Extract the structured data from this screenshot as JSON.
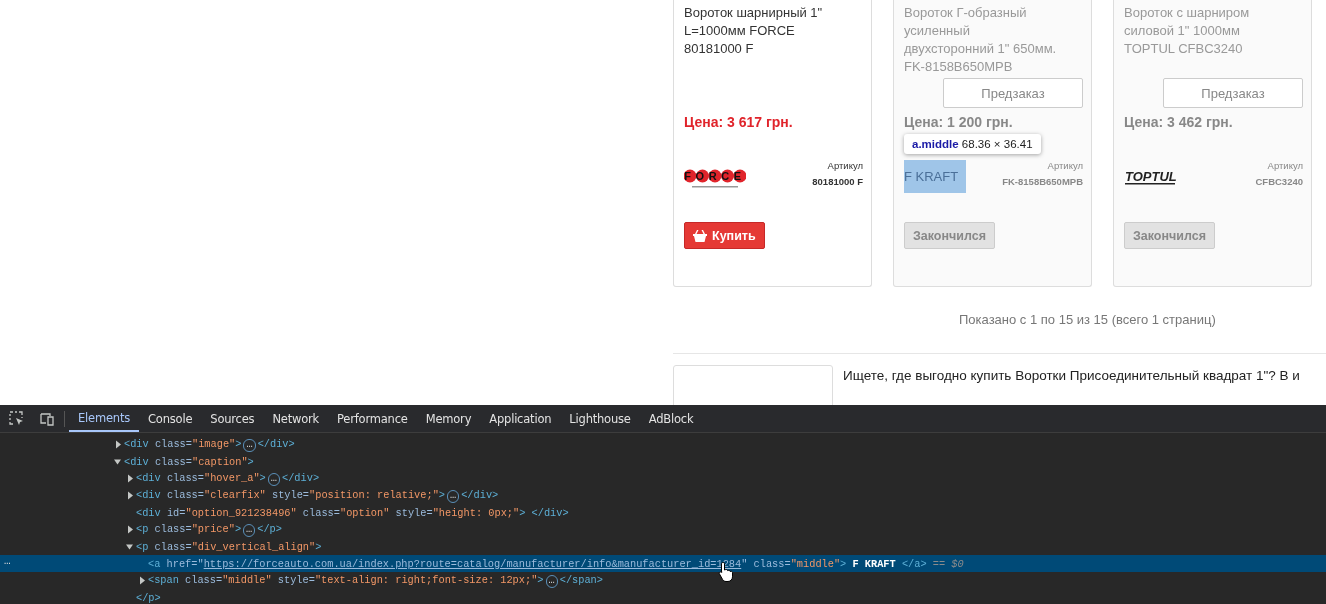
{
  "products": [
    {
      "title": "Вороток шарнирный 1\" L=1000мм FORCE 80181000 F",
      "available": true,
      "price": "Цена: 3 617 грн.",
      "brand": {
        "kind": "force",
        "text": "FORCE",
        "highlighted": false
      },
      "article_label": "Артикул",
      "article": "80181000 F",
      "action_button": "Купить"
    },
    {
      "title": "Вороток Г-образный усиленный двухсторонний 1\" 650мм. FK-8158B650MPB",
      "available": false,
      "preorder_button": "Предзаказ",
      "price": "Цена: 1 200 грн.",
      "brand": {
        "kind": "text",
        "text": "F KRAFT",
        "highlighted": true
      },
      "article_label": "Артикул",
      "article": "FK-8158B650MPB",
      "action_button": "Закончился"
    },
    {
      "title": "Вороток с шарниром силовой 1\" 1000мм TOPTUL CFBC3240",
      "available": false,
      "preorder_button": "Предзаказ",
      "price": "Цена: 3 462 грн.",
      "brand": {
        "kind": "toptul",
        "text": "TOPTUL",
        "highlighted": false
      },
      "article_label": "Артикул",
      "article": "CFBC3240",
      "action_button": "Закончился"
    }
  ],
  "inspect_tooltip": {
    "selector": "a.middle",
    "size": "68.36 × 36.41"
  },
  "pagination": "Показано с 1 по 15 из 15 (всего 1 страниц)",
  "seo_text": "Ищете, где выгодно купить Воротки Присоединительный квадрат 1\"? В и",
  "devtools": {
    "tabs": [
      {
        "label": "Elements",
        "selected": true
      },
      {
        "label": "Console",
        "selected": false
      },
      {
        "label": "Sources",
        "selected": false
      },
      {
        "label": "Network",
        "selected": false
      },
      {
        "label": "Performance",
        "selected": false
      },
      {
        "label": "Memory",
        "selected": false
      },
      {
        "label": "Application",
        "selected": false
      },
      {
        "label": "Lighthouse",
        "selected": false
      },
      {
        "label": "AdBlock",
        "selected": false
      }
    ],
    "dom": [
      {
        "kind": "toggle",
        "expanded": false,
        "selected": false,
        "tokens": [
          {
            "kind": "tag",
            "text": "<div"
          },
          {
            "kind": "attr",
            "text": " class"
          },
          {
            "kind": "eq",
            "text": "="
          },
          {
            "kind": "value",
            "text": "\"image\""
          },
          {
            "kind": "tag",
            "text": ">"
          },
          {
            "kind": "badge",
            "text": "…"
          },
          {
            "kind": "tag",
            "text": "</div>"
          }
        ]
      },
      {
        "kind": "toggle",
        "expanded": true,
        "selected": false,
        "tokens": [
          {
            "kind": "tag",
            "text": "<div"
          },
          {
            "kind": "attr",
            "text": " class"
          },
          {
            "kind": "eq",
            "text": "="
          },
          {
            "kind": "value",
            "text": "\"caption\""
          },
          {
            "kind": "tag",
            "text": ">"
          }
        ],
        "children": [
          {
            "kind": "toggle",
            "expanded": false,
            "selected": false,
            "tokens": [
              {
                "kind": "tag",
                "text": "<div"
              },
              {
                "kind": "attr",
                "text": " class"
              },
              {
                "kind": "eq",
                "text": "="
              },
              {
                "kind": "value",
                "text": "\"hover_a\""
              },
              {
                "kind": "tag",
                "text": ">"
              },
              {
                "kind": "badge",
                "text": "…"
              },
              {
                "kind": "tag",
                "text": "</div>"
              }
            ]
          },
          {
            "kind": "toggle",
            "expanded": false,
            "selected": false,
            "tokens": [
              {
                "kind": "tag",
                "text": "<div"
              },
              {
                "kind": "attr",
                "text": " class"
              },
              {
                "kind": "eq",
                "text": "="
              },
              {
                "kind": "value",
                "text": "\"clearfix\""
              },
              {
                "kind": "attr",
                "text": " style"
              },
              {
                "kind": "eq",
                "text": "="
              },
              {
                "kind": "value",
                "text": "\"position: relative;\""
              },
              {
                "kind": "tag",
                "text": ">"
              },
              {
                "kind": "badge",
                "text": "…"
              },
              {
                "kind": "tag",
                "text": "</div>"
              }
            ]
          },
          {
            "kind": "leaf",
            "selected": false,
            "tokens": [
              {
                "kind": "tag",
                "text": "<div"
              },
              {
                "kind": "attr",
                "text": " id"
              },
              {
                "kind": "eq",
                "text": "="
              },
              {
                "kind": "value",
                "text": "\"option_921238496\""
              },
              {
                "kind": "attr",
                "text": " class"
              },
              {
                "kind": "eq",
                "text": "="
              },
              {
                "kind": "value",
                "text": "\"option\""
              },
              {
                "kind": "attr",
                "text": " style"
              },
              {
                "kind": "eq",
                "text": "="
              },
              {
                "kind": "value",
                "text": "\"height: 0px;\""
              },
              {
                "kind": "tag",
                "text": "> </div>"
              }
            ]
          },
          {
            "kind": "toggle",
            "expanded": false,
            "selected": false,
            "tokens": [
              {
                "kind": "tag",
                "text": "<p"
              },
              {
                "kind": "attr",
                "text": " class"
              },
              {
                "kind": "eq",
                "text": "="
              },
              {
                "kind": "value",
                "text": "\"price\""
              },
              {
                "kind": "tag",
                "text": ">"
              },
              {
                "kind": "badge",
                "text": "…"
              },
              {
                "kind": "tag",
                "text": "</p>"
              }
            ]
          },
          {
            "kind": "toggle",
            "expanded": true,
            "selected": false,
            "tokens": [
              {
                "kind": "tag",
                "text": "<p"
              },
              {
                "kind": "attr",
                "text": " class"
              },
              {
                "kind": "eq",
                "text": "="
              },
              {
                "kind": "value",
                "text": "\"div_vertical_align\""
              },
              {
                "kind": "tag",
                "text": ">"
              }
            ],
            "closing": [
              {
                "kind": "tag",
                "text": "</p>"
              }
            ],
            "children": [
              {
                "kind": "leaf",
                "selected": true,
                "tokens": [
                  {
                    "kind": "tag",
                    "text": "<a"
                  },
                  {
                    "kind": "attr",
                    "text": " href"
                  },
                  {
                    "kind": "eq",
                    "text": "=\""
                  },
                  {
                    "kind": "link",
                    "text": "https://forceauto.com.ua/index.php?route=catalog/manufacturer/info&manufacturer_id=1284"
                  },
                  {
                    "kind": "eq",
                    "text": "\""
                  },
                  {
                    "kind": "attr",
                    "text": " class"
                  },
                  {
                    "kind": "eq",
                    "text": "="
                  },
                  {
                    "kind": "value",
                    "text": "\"middle\""
                  },
                  {
                    "kind": "tag",
                    "text": ">"
                  },
                  {
                    "kind": "text",
                    "text": " F KRAFT "
                  },
                  {
                    "kind": "tag",
                    "text": "</a>"
                  },
                  {
                    "kind": "ref",
                    "text": " == $0"
                  }
                ]
              },
              {
                "kind": "toggle",
                "expanded": false,
                "selected": false,
                "tokens": [
                  {
                    "kind": "tag",
                    "text": "<span"
                  },
                  {
                    "kind": "attr",
                    "text": " class"
                  },
                  {
                    "kind": "eq",
                    "text": "="
                  },
                  {
                    "kind": "value",
                    "text": "\"middle\""
                  },
                  {
                    "kind": "attr",
                    "text": " style"
                  },
                  {
                    "kind": "eq",
                    "text": "="
                  },
                  {
                    "kind": "value",
                    "text": "\"text-align: right;font-size: 12px;\""
                  },
                  {
                    "kind": "tag",
                    "text": ">"
                  },
                  {
                    "kind": "badge",
                    "text": "…"
                  },
                  {
                    "kind": "tag",
                    "text": "</span>"
                  }
                ]
              }
            ]
          }
        ]
      }
    ],
    "selected_marker": "…"
  }
}
